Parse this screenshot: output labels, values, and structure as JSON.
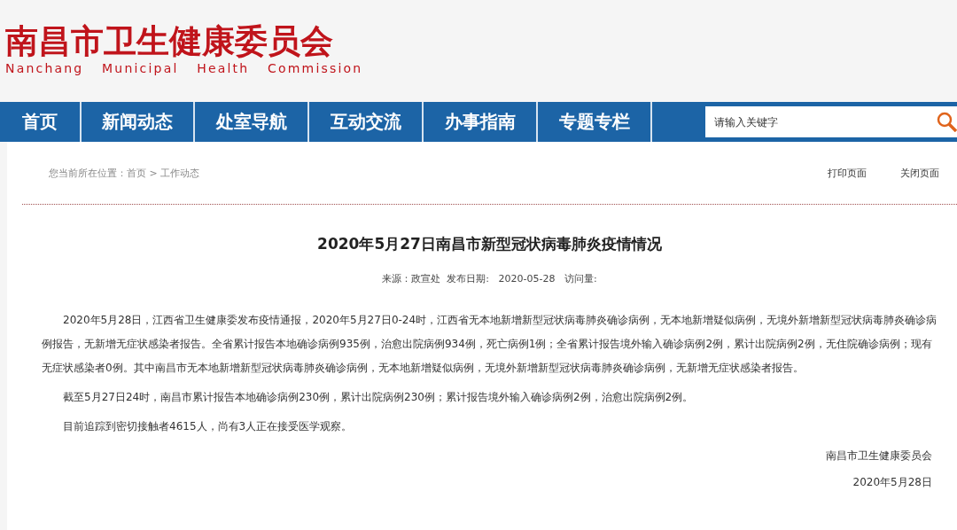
{
  "header": {
    "title": "南昌市卫生健康委员会",
    "subtitle": "Nanchang Municipal Health Commission"
  },
  "nav": {
    "items": [
      {
        "label": "首页"
      },
      {
        "label": "新闻动态"
      },
      {
        "label": "处室导航"
      },
      {
        "label": "互动交流"
      },
      {
        "label": "办事指南"
      },
      {
        "label": "专题专栏"
      }
    ],
    "search": {
      "placeholder": "请输入关键字"
    }
  },
  "toolbar": {
    "breadcrumb": "您当前所在位置：首页 > 工作动态",
    "actions": [
      "打印页面",
      "关闭页面"
    ]
  },
  "article": {
    "title": "2020年5月27日南昌市新型冠状病毒肺炎疫情情况",
    "meta": "来源：政宣处  发布日期:   2020-05-28   访问量:",
    "paragraphs": [
      "2020年5月28日，江西省卫生健康委发布疫情通报，2020年5月27日0-24时，江西省无本地新增新型冠状病毒肺炎确诊病例，无本地新增疑似病例，无境外新增新型冠状病毒肺炎确诊病例报告，无新增无症状感染者报告。全省累计报告本地确诊病例935例，治愈出院病例934例，死亡病例1例；全省累计报告境外输入确诊病例2例，累计出院病例2例，无住院确诊病例；现有无症状感染者0例。其中南昌市无本地新增新型冠状病毒肺炎确诊病例，无本地新增疑似病例，无境外新增新型冠状病毒肺炎确诊病例，无新增无症状感染者报告。",
      "截至5月27日24时，南昌市累计报告本地确诊病例230例，累计出院病例230例；累计报告境外输入确诊病例2例，治愈出院病例2例。",
      "目前追踪到密切接触者4615人，尚有3人正在接受医学观察。"
    ],
    "signature": "南昌市卫生健康委员会",
    "date": "2020年5月28日"
  }
}
